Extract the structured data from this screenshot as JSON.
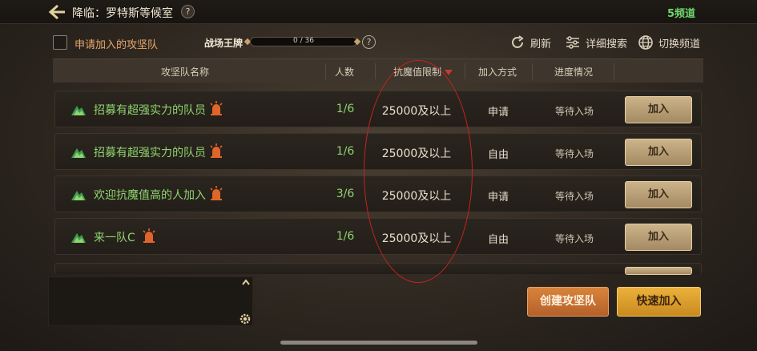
{
  "header": {
    "title": "降临：罗特斯等候室",
    "help_icon_glyph": "?",
    "channel": "5频道"
  },
  "filters": {
    "apply_label": "申请加入的攻坚队",
    "medal_label": "战场王牌",
    "medal_progress_text": "0 / 36",
    "medal_progress_fraction": 0.0,
    "help_glyph": "?",
    "refresh_label": "刷新",
    "detail_search_label": "详细搜索",
    "switch_channel_label": "切换频道"
  },
  "table": {
    "columns": [
      "攻坚队名称",
      "人数",
      "抗魔值限制",
      "加入方式",
      "进度情况"
    ],
    "rows": [
      {
        "name": "招募有超强实力的队员",
        "count": "1/6",
        "limit": "25000及以上",
        "join_mode": "申请",
        "progress": "等待入场",
        "button": "加入"
      },
      {
        "name": "招募有超强实力的队员",
        "count": "1/6",
        "limit": "25000及以上",
        "join_mode": "自由",
        "progress": "等待入场",
        "button": "加入"
      },
      {
        "name": "欢迎抗魔值高的人加入",
        "count": "3/6",
        "limit": "25000及以上",
        "join_mode": "申请",
        "progress": "等待入场",
        "button": "加入"
      },
      {
        "name": "来一队C",
        "count": "1/6",
        "limit": "25000及以上",
        "join_mode": "自由",
        "progress": "等待入场",
        "button": "加入"
      }
    ]
  },
  "footer": {
    "create_label": "创建攻坚队",
    "quick_join_label": "快速加入"
  },
  "colors": {
    "accent_green": "#8fd46e",
    "channel_green": "#6fd66a",
    "annotation_red": "#c3241f",
    "create_orange": "#d9843a",
    "quick_gold": "#ecb13c"
  }
}
